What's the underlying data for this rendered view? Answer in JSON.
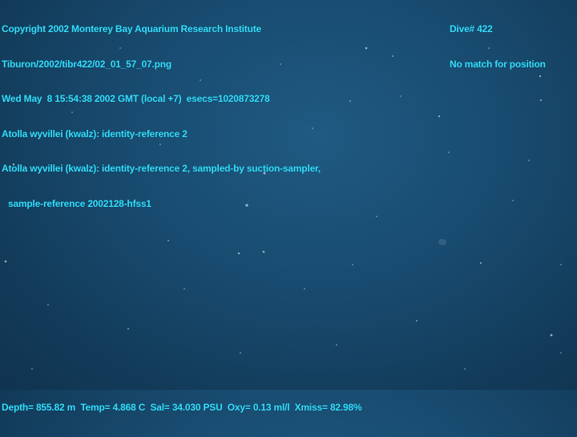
{
  "overlay": {
    "top_left_lines": [
      "Copyright 2002 Monterey Bay Aquarium Research Institute",
      "Tiburon/2002/tibr422/02_01_57_07.png",
      "Wed May  8 15:54:38 2002 GMT (local +7)  esecs=1020873278",
      "Atolla wyvillei (kwalz): identity-reference 2",
      "Atolla wyvillei (kwalz): identity-reference 2, sampled-by suction-sampler,",
      "sample-reference 2002128-hfss1"
    ],
    "top_right_lines": [
      "Dive# 422",
      "No match for position"
    ],
    "bottom_line": "Depth= 855.82 m  Temp= 4.868 C  Sal= 34.030 PSU  Oxy= 0.13 ml/l  Xmiss= 82.98%"
  },
  "colors": {
    "overlay_text": "#33e0ff",
    "water": "#184a6e"
  }
}
